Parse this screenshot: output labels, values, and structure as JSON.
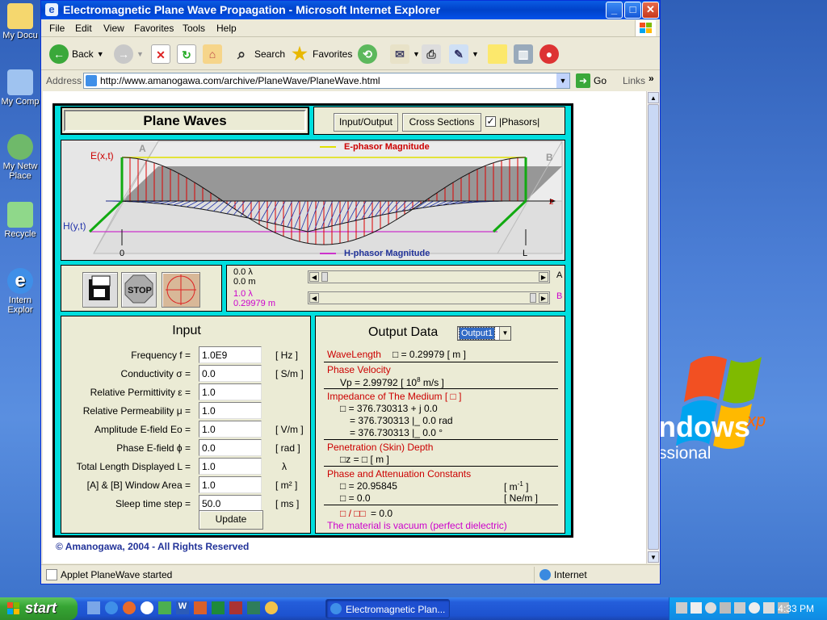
{
  "desktop": {
    "icons": [
      {
        "label": "My Docu",
        "icon": "folder-icon"
      },
      {
        "label": "My Comp",
        "icon": "computer-icon"
      },
      {
        "label": "My Netw Place",
        "icon": "network-icon"
      },
      {
        "label": "Recycle",
        "icon": "recycle-bin-icon"
      },
      {
        "label": "Intern Explor",
        "icon": "ie-icon"
      }
    ],
    "wallpaper_text": {
      "word": "ndows",
      "sup": "xp",
      "edition": "ssional"
    }
  },
  "window": {
    "title": "Electromagnetic Plane Wave Propagation - Microsoft Internet Explorer",
    "menu": [
      "File",
      "Edit",
      "View",
      "Favorites",
      "Tools",
      "Help"
    ],
    "toolbar": {
      "back": "Back",
      "search": "Search",
      "favorites": "Favorites"
    },
    "address": {
      "label": "Address",
      "url": "http://www.amanogawa.com/archive/PlaneWave/PlaneWave.html",
      "go": "Go",
      "links": "Links"
    },
    "status": {
      "text": "Applet PlaneWave started",
      "zone": "Internet"
    }
  },
  "applet": {
    "title": "Plane Waves",
    "buttons": {
      "io": "Input/Output",
      "cross": "Cross Sections",
      "phasors": "|Phasors|"
    },
    "phasors_checked": true,
    "plot": {
      "e_label": "E(x,t)",
      "h_label": "H(y,t)",
      "z_label": "z",
      "a_label": "A",
      "b_label": "B",
      "zero_label": "0",
      "l_label": "L",
      "e_legend": "E-phasor Magnitude",
      "h_legend": "H-phasor Magnitude"
    },
    "controls": {
      "stop": "STOP"
    },
    "window_a": {
      "lambda": "0.0 λ",
      "m": "0.0 m",
      "tag": "A"
    },
    "window_b": {
      "lambda": "1.0 λ",
      "m": "0.29979 m",
      "tag": "B"
    },
    "input": {
      "heading": "Input",
      "rows": [
        {
          "label": "Frequency  f =",
          "value": "1.0E9",
          "unit": "[ Hz ]"
        },
        {
          "label": "Conductivity  σ =",
          "value": "0.0",
          "unit": "[ S/m ]"
        },
        {
          "label": "Relative Permittivity  ε =",
          "value": "1.0",
          "unit": ""
        },
        {
          "label": "Relative Permeability  μ =",
          "value": "1.0",
          "unit": ""
        },
        {
          "label": "Amplitude E-field  Eo =",
          "value": "1.0",
          "unit": "[ V/m ]"
        },
        {
          "label": "Phase E-field  ϕ =",
          "value": "0.0",
          "unit": "[ rad ]"
        },
        {
          "label": "Total Length Displayed  L =",
          "value": "1.0",
          "unit": "λ"
        },
        {
          "label": "[A] & [B] Window Area  =",
          "value": "1.0",
          "unit": "[ m² ]"
        },
        {
          "label": "Sleep time step  =",
          "value": "50.0",
          "unit": "[ ms ]"
        }
      ],
      "update": "Update"
    },
    "output": {
      "heading": "Output Data",
      "select": "Output1",
      "wavelength_label": "WaveLength",
      "wavelength_value": "□  = 0.29979  [ m ]",
      "phase_velocity_label": "Phase Velocity",
      "vp_value": "Vp  =  2.99792  [ 10",
      "vp_exp": "8",
      "vp_unit": " m/s ]",
      "impedance_label": "Impedance of The Medium  [ □ ]",
      "imp_line1": "□  =  376.730313 + j 0.0",
      "imp_line2": "=  376.730313  |_ 0.0 rad",
      "imp_line3": "=  376.730313  |_ 0.0 °",
      "skin_label": "Penetration (Skin) Depth",
      "skin_value": "□z =  □   [ m ]",
      "const_label": "Phase and Attenuation Constants",
      "beta_value": "□  =  20.95845",
      "beta_unit": "[ m",
      "beta_unit_exp": "-1",
      "beta_unit_end": " ]",
      "alpha_value": "□  =  0.0",
      "alpha_unit": "[ Ne/m ]",
      "ratio_sym": "□ / □□",
      "ratio_value": "= 0.0",
      "vacuum_note": "The material is vacuum (perfect dielectric)"
    },
    "copyright": "© Amanogawa, 2004 - All Rights Reserved"
  },
  "taskbar": {
    "start": "start",
    "task": "Electromagnetic Plan...",
    "clock": "4:33 PM"
  }
}
